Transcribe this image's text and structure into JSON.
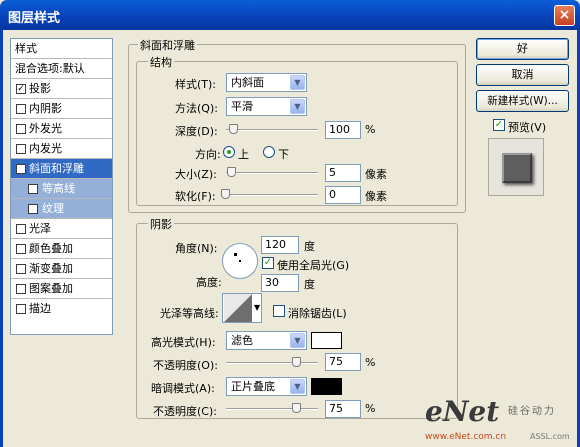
{
  "window": {
    "title": "图层样式",
    "close_icon": "×"
  },
  "sidebar": {
    "items": [
      {
        "label": "样式",
        "checkbox": false,
        "checked": false,
        "state": "normal"
      },
      {
        "label": "混合选项:默认",
        "checkbox": false,
        "checked": false,
        "state": "normal"
      },
      {
        "label": "投影",
        "checkbox": true,
        "checked": true,
        "state": "normal"
      },
      {
        "label": "内阴影",
        "checkbox": true,
        "checked": false,
        "state": "normal"
      },
      {
        "label": "外发光",
        "checkbox": true,
        "checked": false,
        "state": "normal"
      },
      {
        "label": "内发光",
        "checkbox": true,
        "checked": false,
        "state": "normal"
      },
      {
        "label": "斜面和浮雕",
        "checkbox": true,
        "checked": true,
        "state": "selected"
      },
      {
        "label": "等高线",
        "checkbox": true,
        "checked": false,
        "state": "sub"
      },
      {
        "label": "纹理",
        "checkbox": true,
        "checked": false,
        "state": "sub"
      },
      {
        "label": "光泽",
        "checkbox": true,
        "checked": false,
        "state": "normal"
      },
      {
        "label": "颜色叠加",
        "checkbox": true,
        "checked": false,
        "state": "normal"
      },
      {
        "label": "渐变叠加",
        "checkbox": true,
        "checked": false,
        "state": "normal"
      },
      {
        "label": "图案叠加",
        "checkbox": true,
        "checked": false,
        "state": "normal"
      },
      {
        "label": "描边",
        "checkbox": true,
        "checked": false,
        "state": "normal"
      }
    ]
  },
  "bevel": {
    "group_title": "斜面和浮雕",
    "structure_title": "结构",
    "style_label": "样式(T):",
    "style_value": "内斜面",
    "method_label": "方法(Q):",
    "method_value": "平滑",
    "depth_label": "深度(D):",
    "depth_value": "100",
    "depth_unit": "%",
    "direction_label": "方向:",
    "dir_up": "上",
    "dir_down": "下",
    "size_label": "大小(Z):",
    "size_value": "5",
    "size_unit": "像素",
    "soften_label": "软化(F):",
    "soften_value": "0",
    "soften_unit": "像素"
  },
  "shading": {
    "group_title": "阴影",
    "angle_label": "角度(N):",
    "angle_value": "120",
    "angle_unit": "度",
    "global_light_label": "使用全局光(G)",
    "global_light_checked": true,
    "altitude_label": "高度:",
    "altitude_value": "30",
    "altitude_unit": "度",
    "gloss_label": "光泽等高线:",
    "antialias_label": "消除锯齿(L)",
    "antialias_checked": false,
    "highlight_label": "高光模式(H):",
    "highlight_value": "滤色",
    "highlight_color": "#ffffff",
    "h_opacity_label": "不透明度(O):",
    "h_opacity_value": "75",
    "h_opacity_unit": "%",
    "shadow_label": "暗调模式(A):",
    "shadow_value": "正片叠底",
    "shadow_color": "#000000",
    "s_opacity_label": "不透明度(C):",
    "s_opacity_value": "75",
    "s_opacity_unit": "%"
  },
  "buttons": {
    "ok": "好",
    "cancel": "取消",
    "new_style": "新建样式(W)...",
    "preview": "预览(V)",
    "preview_checked": true
  },
  "watermark": {
    "brand": "eNet",
    "site": "www.eNet.com.cn",
    "tag": "硅谷动力",
    "logo2": "ASSL.com"
  }
}
